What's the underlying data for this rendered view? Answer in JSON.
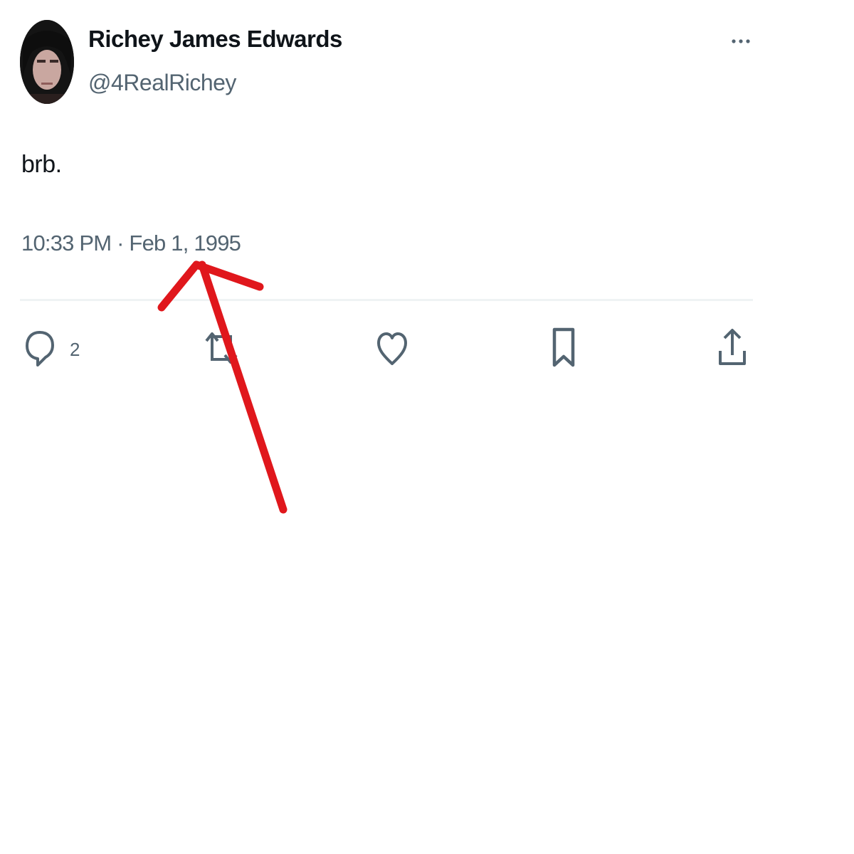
{
  "tweet": {
    "author": {
      "display_name": "Richey James Edwards",
      "handle": "@4RealRichey"
    },
    "text": "brb.",
    "timestamp": "10:33 PM · Feb 1, 1995",
    "actions": {
      "reply_count": "2"
    }
  },
  "icons": {
    "more": "more-horizontal-icon",
    "reply": "reply-icon",
    "retweet": "retweet-icon",
    "like": "heart-icon",
    "bookmark": "bookmark-icon",
    "share": "share-icon"
  },
  "colors": {
    "text_primary": "#0f1419",
    "text_secondary": "#536471",
    "divider": "#eff3f4",
    "annotation_arrow": "#e0171c"
  }
}
